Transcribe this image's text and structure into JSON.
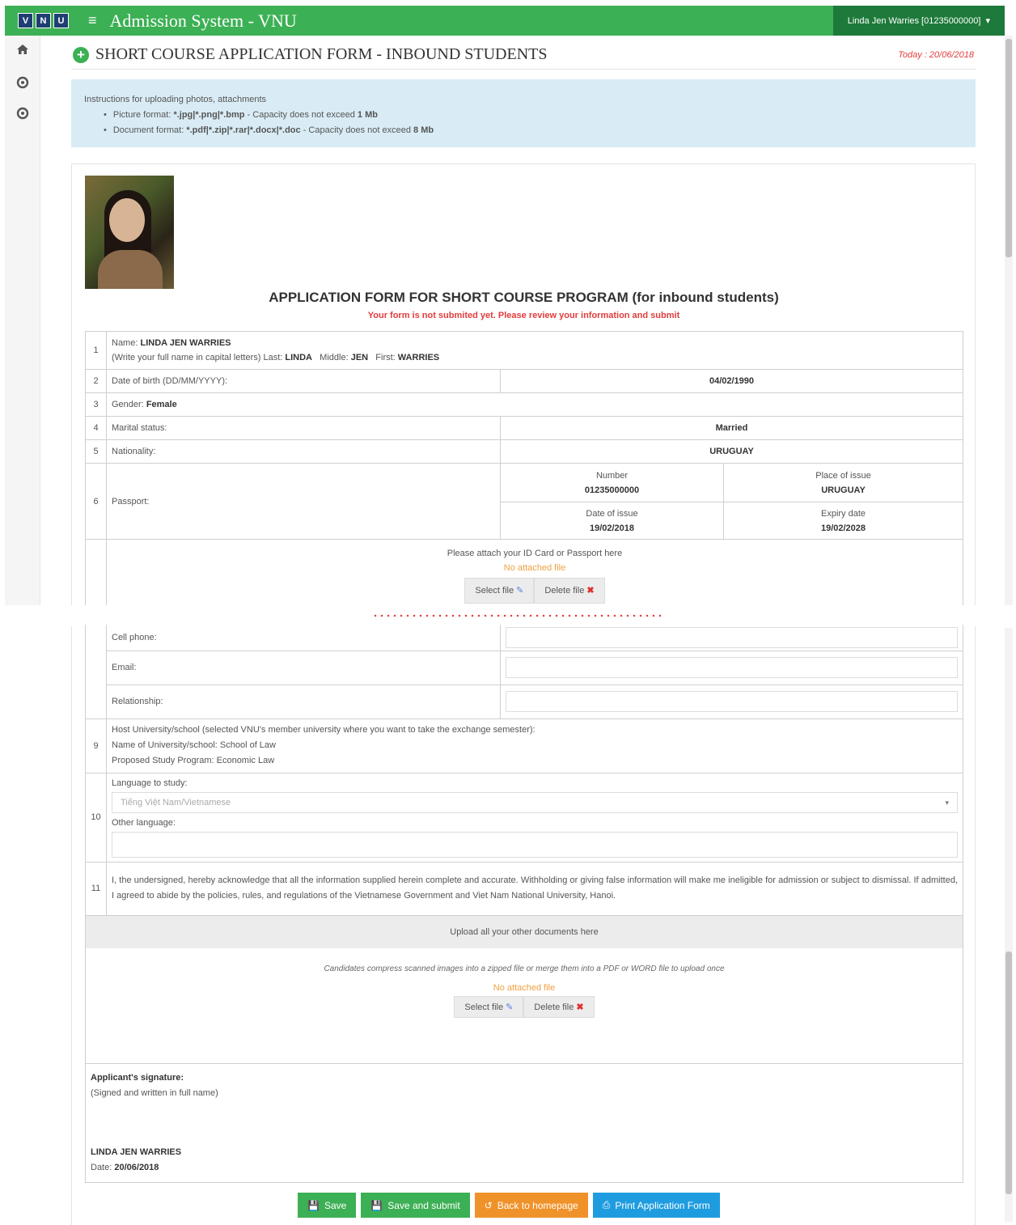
{
  "header": {
    "logo_letters": [
      "V",
      "N",
      "U"
    ],
    "menu_icon": "hamburger-icon",
    "app_title": "Admission System - VNU",
    "user_menu": "Linda Jen Warries [01235000000]",
    "user_caret": "▾"
  },
  "sidebar": {
    "icons": [
      "home-icon",
      "circle-icon",
      "circle-icon"
    ]
  },
  "page": {
    "title": "SHORT COURSE APPLICATION FORM - INBOUND STUDENTS",
    "today_label": "Today : 20/06/2018"
  },
  "instructions": {
    "heading": "Instructions for uploading photos, attachments",
    "picture_prefix": "Picture format: ",
    "picture_formats": "*.jpg|*.png|*.bmp",
    "picture_suffix": " - Capacity does not exceed ",
    "picture_limit": "1 Mb",
    "document_prefix": "Document format: ",
    "document_formats": "*.pdf|*.zip|*.rar|*.docx|*.doc",
    "document_suffix": " - Capacity does not exceed ",
    "document_limit": "8 Mb"
  },
  "form": {
    "title": "APPLICATION FORM FOR SHORT COURSE PROGRAM (for inbound students)",
    "warning": "Your form is not submited yet. Please review your information and submit",
    "row1": {
      "num": "1",
      "name_label": "Name: ",
      "name_value": "LINDA JEN WARRIES",
      "hint": "(Write your full name in capital letters) Last: ",
      "last": "LINDA",
      "middle_label": "Middle: ",
      "middle": "JEN",
      "first_label": "First: ",
      "first": "WARRIES"
    },
    "row2": {
      "num": "2",
      "label": "Date of birth (DD/MM/YYYY):",
      "value": "04/02/1990"
    },
    "row3": {
      "num": "3",
      "label": "Gender: ",
      "value": "Female"
    },
    "row4": {
      "num": "4",
      "label": "Marital status:",
      "value": "Married"
    },
    "row5": {
      "num": "5",
      "label": "Nationality:",
      "value": "URUGUAY"
    },
    "row6": {
      "num": "6",
      "label": "Passport:",
      "number_label": "Number",
      "number_value": "01235000000",
      "place_label": "Place of issue",
      "place_value": "URUGUAY",
      "issue_label": "Date of issue",
      "issue_value": "19/02/2018",
      "expiry_label": "Expiry date",
      "expiry_value": "19/02/2028"
    },
    "attach": {
      "prompt": "Please attach your ID Card or Passport here",
      "status": "No attached file",
      "select_label": "Select file",
      "delete_label": "Delete file"
    },
    "contact": {
      "cell_label": "Cell phone:",
      "cell_value": "",
      "email_label": "Email:",
      "email_value": "",
      "relationship_label": "Relationship:",
      "relationship_value": ""
    },
    "row9": {
      "num": "9",
      "line1": "Host University/school (selected VNU's member university where you want to take the exchange semester):",
      "line2": "Name of University/school: School of Law",
      "line3": "Proposed Study Program: Economic Law"
    },
    "row10": {
      "num": "10",
      "language_label": "Language to study:",
      "language_value": "Tiếng Việt Nam/Vietnamese",
      "other_label": "Other language:",
      "other_value": ""
    },
    "row11": {
      "num": "11",
      "text": "I, the undersigned, hereby acknowledge that all the information supplied herein complete and accurate. Withholding or giving false information will make me ineligible for admission or subject to dismissal. If admitted, I agreed to abide by the policies, rules, and regulations of the Vietnamese Government and Viet Nam National University, Hanoi."
    },
    "upload": {
      "heading": "Upload all your other documents here",
      "hint": "Candidates compress scanned images into a zipped file or merge them into a PDF or WORD file to upload once",
      "status": "No attached file",
      "select_label": "Select file",
      "delete_label": "Delete file"
    },
    "signature": {
      "heading": "Applicant's signature:",
      "note": "(Signed and written in full name)",
      "name": "LINDA JEN WARRIES",
      "date_label": "Date: ",
      "date_value": "20/06/2018"
    }
  },
  "actions": {
    "save": "Save",
    "save_submit": "Save and submit",
    "back": "Back to homepage",
    "print": "Print Application Form"
  },
  "colors": {
    "brand_green": "#3cb054",
    "dark_green": "#1e7a3a",
    "alert_red": "#e23b3b",
    "info_bg": "#d9ecf5",
    "orange": "#f0922a",
    "blue": "#1f9ce0"
  }
}
